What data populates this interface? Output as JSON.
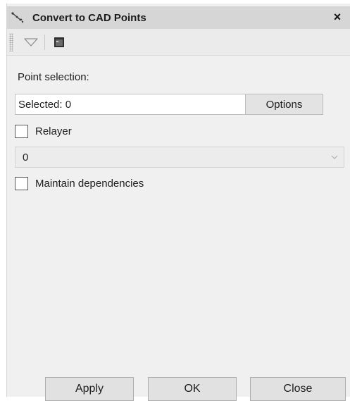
{
  "window": {
    "title": "Convert to CAD Points",
    "title_icon": "convert-points-icon",
    "close_label": "×"
  },
  "toolbar": {
    "dropdown_icon": "triangle-down-icon",
    "console_icon": "console-window-icon"
  },
  "form": {
    "point_selection_label": "Point selection:",
    "selection_value": "Selected: 0",
    "options_label": "Options",
    "relayer_label": "Relayer",
    "relayer_checked": false,
    "layer_value": "0",
    "maintain_label": "Maintain dependencies",
    "maintain_checked": false
  },
  "footer": {
    "apply_label": "Apply",
    "ok_label": "OK",
    "close_label": "Close"
  },
  "colors": {
    "panel_bg": "#f0f0f0",
    "titlebar_bg": "#d6d6d6",
    "button_bg": "#e1e1e1"
  }
}
